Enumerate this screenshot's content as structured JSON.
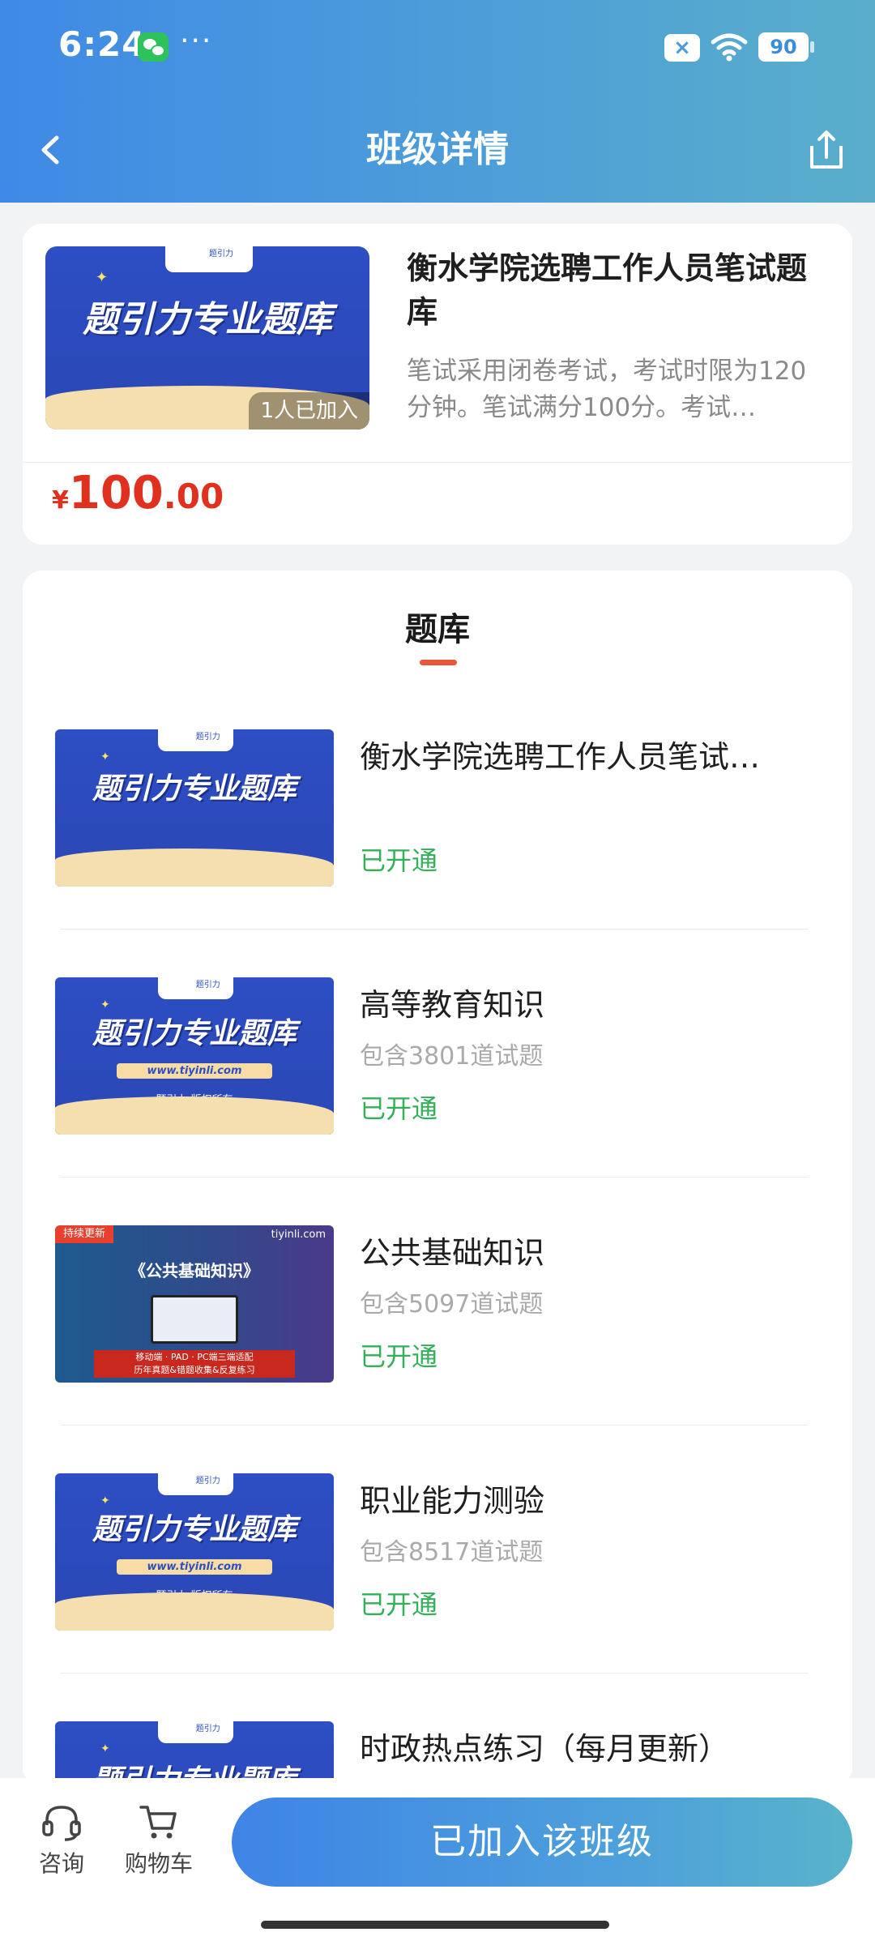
{
  "status_bar": {
    "time": "6:24",
    "more": "···",
    "battery": "90",
    "sim": "×"
  },
  "header": {
    "title": "班级详情"
  },
  "course": {
    "cover_big": "题引力专业题库",
    "cover_small": "题引力 版权所有",
    "join_badge": "1人已加入",
    "title": "衡水学院选聘工作人员笔试题库",
    "description": "笔试采用闭卷考试，考试时限为120分钟。笔试满分100分。考试…",
    "price": {
      "currency": "¥",
      "integer": "100",
      "decimal": ".00"
    }
  },
  "bank": {
    "section_title": "题库",
    "items": [
      {
        "title": "衡水学院选聘工作人员笔试…",
        "count": "",
        "status": "已开通",
        "cover": "brand"
      },
      {
        "title": "高等教育知识",
        "count": "包含3801道试题",
        "status": "已开通",
        "cover": "brand-url"
      },
      {
        "title": "公共基础知识",
        "count": "包含5097道试题",
        "status": "已开通",
        "cover": "gov"
      },
      {
        "title": "职业能力测验",
        "count": "包含8517道试题",
        "status": "已开通",
        "cover": "brand-url"
      },
      {
        "title": "时政热点练习（每月更新）",
        "count": "",
        "status": "",
        "cover": "brand"
      }
    ],
    "cover_texts": {
      "big": "题引力专业题库",
      "small": "题引力 版权所有",
      "url": "www.tiyinli.com",
      "gov_tag": "持续更新",
      "gov_logo": "tiyinli.com",
      "gov_title": "《公共基础知识》",
      "gov_band_1": "移动端 · PAD · PC端三端适配",
      "gov_band_2": "历年真题&错题收集&反复练习"
    }
  },
  "bottom_bar": {
    "consult_label": "咨询",
    "cart_label": "购物车",
    "join_button": "已加入该班级"
  },
  "colors": {
    "accent": "#3f8ae6",
    "price": "#e0301e",
    "status_open": "#33b05a",
    "underline": "#e9583a"
  }
}
